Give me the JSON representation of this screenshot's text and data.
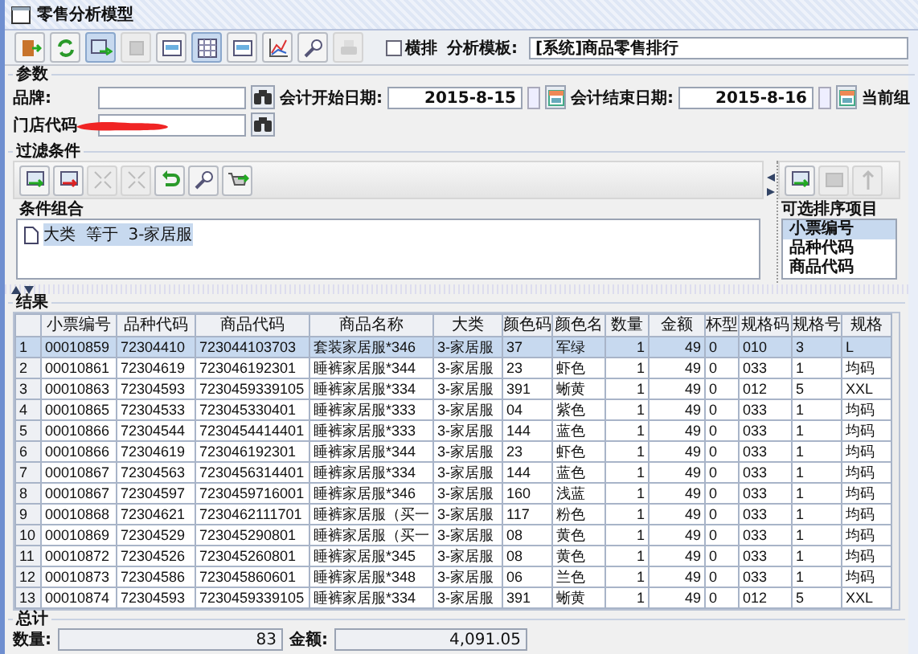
{
  "window": {
    "title": "零售分析模型"
  },
  "toolbar": {
    "buttons": [
      {
        "kind": "exit",
        "disabled": false,
        "pressed": false
      },
      {
        "kind": "refresh",
        "disabled": false,
        "pressed": false
      },
      {
        "kind": "run",
        "disabled": false,
        "pressed": true
      },
      {
        "kind": "stop",
        "disabled": true,
        "pressed": false
      },
      {
        "kind": "panel",
        "disabled": false,
        "pressed": false
      },
      {
        "kind": "grid",
        "disabled": false,
        "pressed": true
      },
      {
        "kind": "panel",
        "disabled": false,
        "pressed": false
      },
      {
        "kind": "chart",
        "disabled": false,
        "pressed": false
      },
      {
        "kind": "find",
        "disabled": false,
        "pressed": false
      },
      {
        "kind": "print",
        "disabled": true,
        "pressed": false
      }
    ],
    "layout_checkbox": {
      "label": "横排",
      "checked": false
    },
    "template": {
      "label": "分析模板:",
      "value": "[系统]商品零售排行"
    }
  },
  "parameters": {
    "title": "参数",
    "brand": {
      "label": "品牌:"
    },
    "start_date": {
      "label": "会计开始日期:",
      "value": "2015-8-15"
    },
    "end_date": {
      "label": "会计结束日期:",
      "value": "2015-8-16"
    },
    "current_org": {
      "label": "当前组"
    },
    "store_code": {
      "label": "门店代码"
    }
  },
  "filter": {
    "title": "过滤条件",
    "tools": [
      {
        "kind": "add",
        "disabled": false
      },
      {
        "kind": "remove",
        "disabled": false
      },
      {
        "kind": "expand",
        "disabled": true
      },
      {
        "kind": "collapse",
        "disabled": true
      },
      {
        "kind": "undo",
        "disabled": false
      },
      {
        "kind": "find",
        "disabled": false
      },
      {
        "kind": "apply",
        "disabled": false
      }
    ],
    "conditions": {
      "title": "条件组合",
      "items": [
        {
          "text": "大类  等于  3-家居服",
          "selected": true
        }
      ]
    },
    "sort": {
      "tools": [
        {
          "kind": "add",
          "disabled": false
        },
        {
          "kind": "stop",
          "disabled": true
        },
        {
          "kind": "up",
          "disabled": true
        }
      ],
      "title": "可选排序项目",
      "items": [
        {
          "text": "小票编号",
          "selected": true
        },
        {
          "text": "品种代码",
          "selected": false
        },
        {
          "text": "商品代码",
          "selected": false
        }
      ]
    }
  },
  "results": {
    "title": "结果",
    "columns": [
      "小票编号",
      "品种代码",
      "商品代码",
      "商品名称",
      "大类",
      "颜色码",
      "颜色名",
      "数量",
      "金额",
      "杯型",
      "规格码",
      "规格号",
      "规格"
    ],
    "rows": [
      {
        "number": "1",
        "selected": true,
        "cells": [
          "00010859",
          "72304410",
          "723044103703",
          "套装家居服*346",
          "3-家居服",
          "37",
          "军绿",
          "1",
          "49",
          "0",
          "010",
          "3",
          "L"
        ]
      },
      {
        "number": "2",
        "selected": false,
        "cells": [
          "00010861",
          "72304619",
          "723046192301",
          "睡裤家居服*344",
          "3-家居服",
          "23",
          "虾色",
          "1",
          "49",
          "0",
          "033",
          "1",
          "均码"
        ]
      },
      {
        "number": "3",
        "selected": false,
        "cells": [
          "00010863",
          "72304593",
          "7230459339105",
          "睡裤家居服*334",
          "3-家居服",
          "391",
          "蜥黄",
          "1",
          "49",
          "0",
          "012",
          "5",
          "XXL"
        ]
      },
      {
        "number": "4",
        "selected": false,
        "cells": [
          "00010865",
          "72304533",
          "723045330401",
          "睡裤家居服*333",
          "3-家居服",
          "04",
          "紫色",
          "1",
          "49",
          "0",
          "033",
          "1",
          "均码"
        ]
      },
      {
        "number": "5",
        "selected": false,
        "cells": [
          "00010866",
          "72304544",
          "7230454414401",
          "睡裤家居服*333",
          "3-家居服",
          "144",
          "蓝色",
          "1",
          "49",
          "0",
          "033",
          "1",
          "均码"
        ]
      },
      {
        "number": "6",
        "selected": false,
        "cells": [
          "00010866",
          "72304619",
          "723046192301",
          "睡裤家居服*344",
          "3-家居服",
          "23",
          "虾色",
          "1",
          "49",
          "0",
          "033",
          "1",
          "均码"
        ]
      },
      {
        "number": "7",
        "selected": false,
        "cells": [
          "00010867",
          "72304563",
          "7230456314401",
          "睡裤家居服*334",
          "3-家居服",
          "144",
          "蓝色",
          "1",
          "49",
          "0",
          "033",
          "1",
          "均码"
        ]
      },
      {
        "number": "8",
        "selected": false,
        "cells": [
          "00010867",
          "72304597",
          "7230459716001",
          "睡裤家居服*346",
          "3-家居服",
          "160",
          "浅蓝",
          "1",
          "49",
          "0",
          "033",
          "1",
          "均码"
        ]
      },
      {
        "number": "9",
        "selected": false,
        "cells": [
          "00010868",
          "72304621",
          "7230462111701",
          "睡裤家居服（买一",
          "3-家居服",
          "117",
          "粉色",
          "1",
          "49",
          "0",
          "033",
          "1",
          "均码"
        ]
      },
      {
        "number": "10",
        "selected": false,
        "cells": [
          "00010869",
          "72304529",
          "723045290801",
          "睡裤家居服（买一",
          "3-家居服",
          "08",
          "黄色",
          "1",
          "49",
          "0",
          "033",
          "1",
          "均码"
        ]
      },
      {
        "number": "11",
        "selected": false,
        "cells": [
          "00010872",
          "72304526",
          "723045260801",
          "睡裤家居服*345",
          "3-家居服",
          "08",
          "黄色",
          "1",
          "49",
          "0",
          "033",
          "1",
          "均码"
        ]
      },
      {
        "number": "12",
        "selected": false,
        "cells": [
          "00010873",
          "72304586",
          "723045860601",
          "睡裤家居服*348",
          "3-家居服",
          "06",
          "兰色",
          "1",
          "49",
          "0",
          "033",
          "1",
          "均码"
        ]
      },
      {
        "number": "13",
        "selected": false,
        "cells": [
          "00010874",
          "72304593",
          "7230459339105",
          "睡裤家居服*334",
          "3-家居服",
          "391",
          "蜥黄",
          "1",
          "49",
          "0",
          "012",
          "5",
          "XXL"
        ]
      }
    ]
  },
  "totals": {
    "title": "总计",
    "quantity": {
      "label": "数量:",
      "value": "83"
    },
    "amount": {
      "label": "金额:",
      "value": "4,091.05"
    }
  }
}
